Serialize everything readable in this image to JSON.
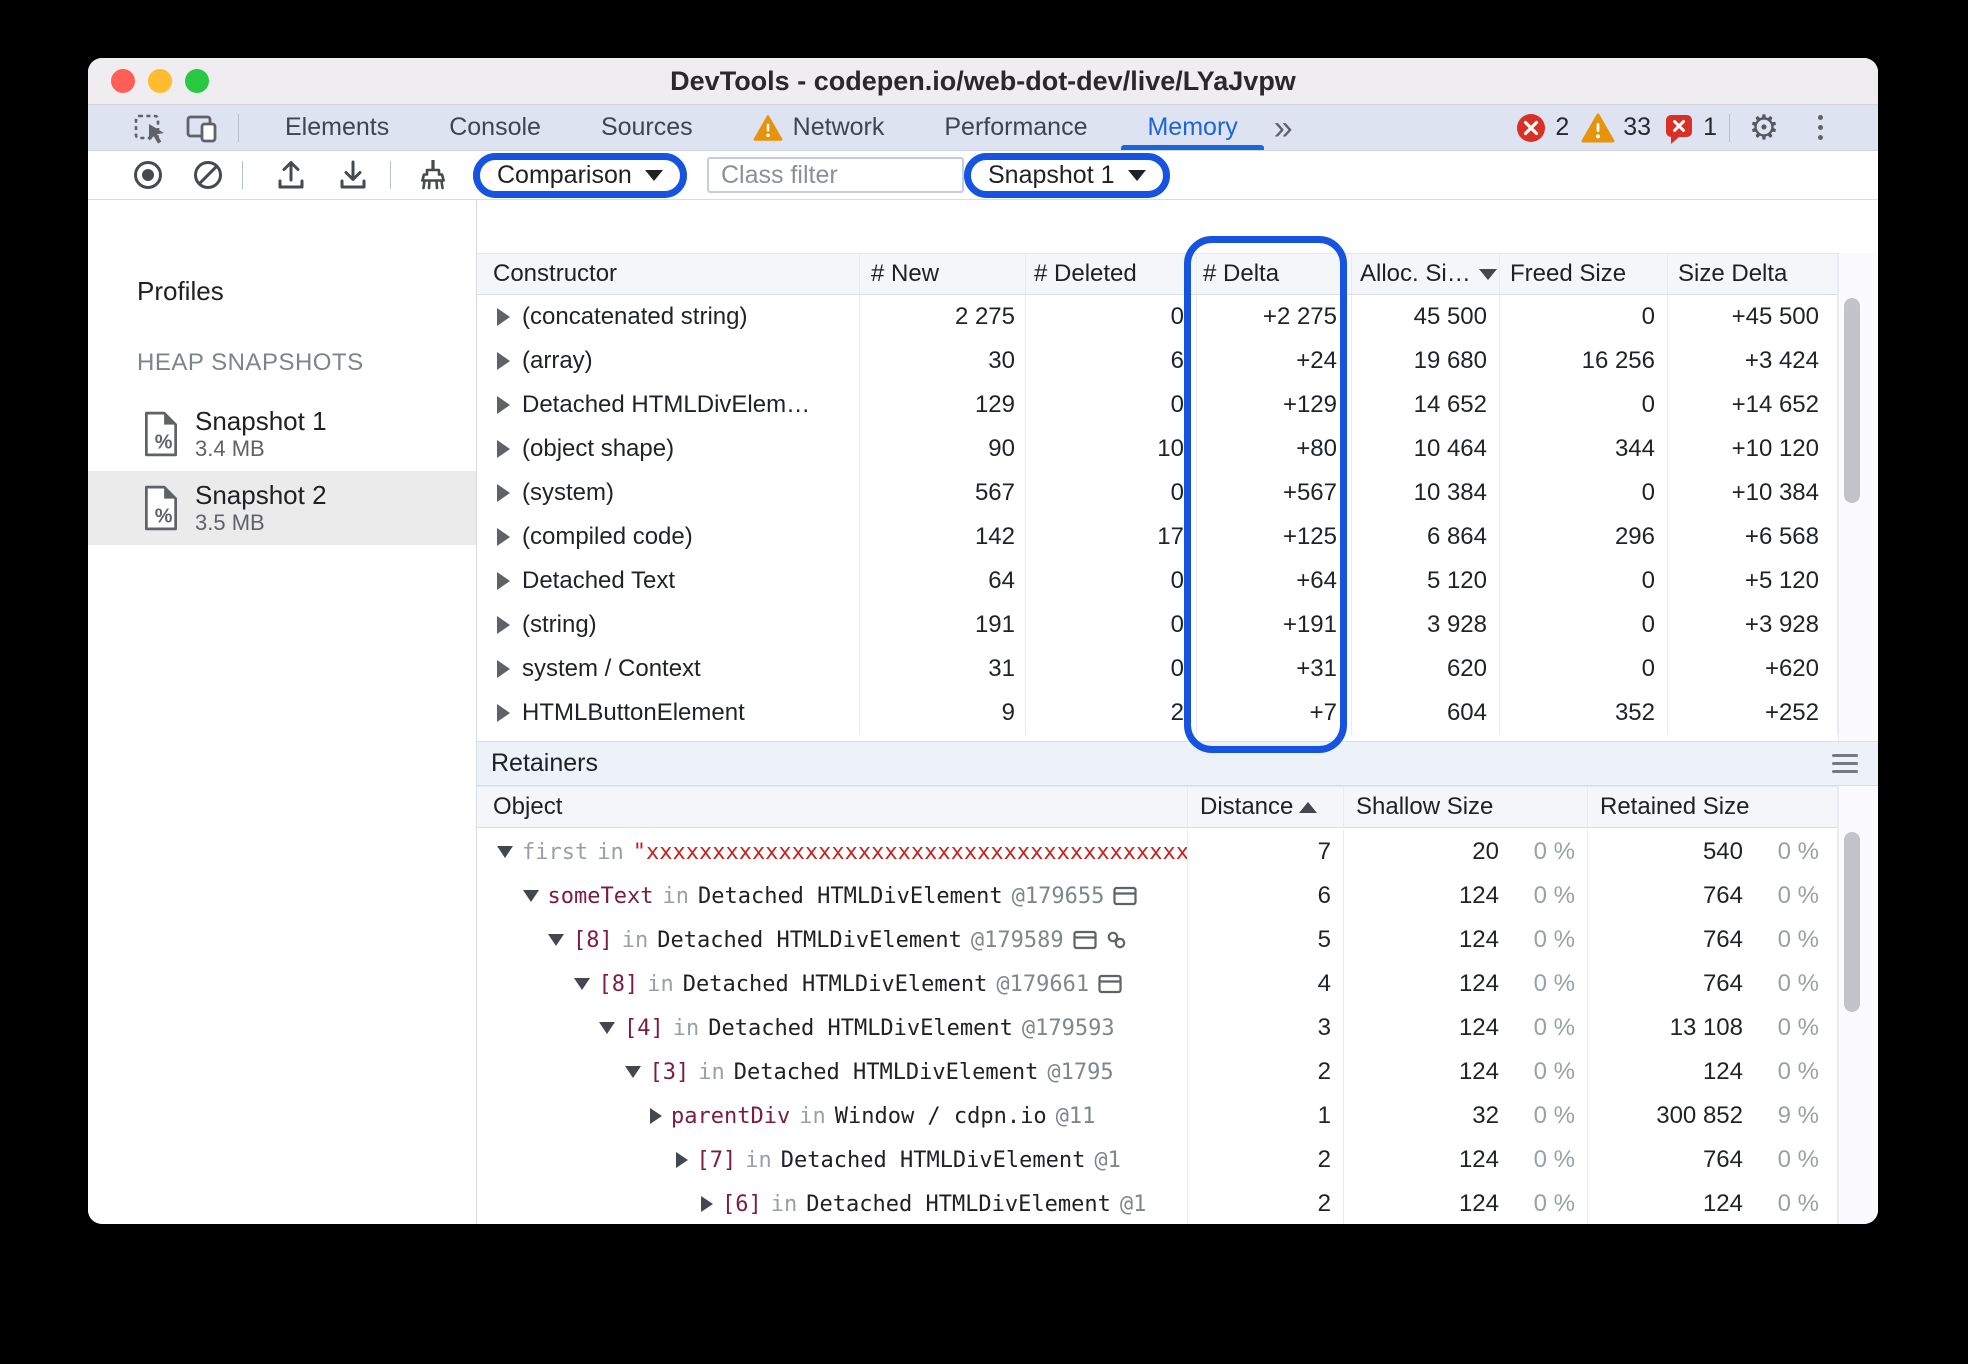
{
  "titlebar": {
    "title": "DevTools - codepen.io/web-dot-dev/live/LYaJvpw"
  },
  "tabbar": {
    "tabs": [
      {
        "label": "Elements"
      },
      {
        "label": "Console"
      },
      {
        "label": "Sources"
      },
      {
        "label": "Network",
        "warning": true
      },
      {
        "label": "Performance"
      },
      {
        "label": "Memory",
        "selected": true
      }
    ],
    "more_tabs_icon": "»",
    "gear_icon": "⚙",
    "badges": {
      "errors": "2",
      "warnings": "33",
      "issues": "1"
    }
  },
  "toolbar": {
    "comparison_label": "Comparison",
    "class_filter_placeholder": "Class filter",
    "snapshot_label": "Snapshot 1"
  },
  "sidebar": {
    "profiles_label": "Profiles",
    "section_label": "HEAP SNAPSHOTS",
    "snapshots": [
      {
        "name": "Snapshot 1",
        "size": "3.4 MB",
        "selected": false
      },
      {
        "name": "Snapshot 2",
        "size": "3.5 MB",
        "selected": true
      }
    ]
  },
  "comparison_table": {
    "columns": [
      "Constructor",
      "# New",
      "# Deleted",
      "# Delta",
      "Alloc. Si…",
      "Freed Size",
      "Size Delta"
    ],
    "sorted_column": "Alloc. Si…",
    "sort_direction": "desc",
    "highlighted_column": "# Delta",
    "rows": [
      {
        "constructor": "(concatenated string)",
        "new": "2 275",
        "deleted": "0",
        "delta": "+2 275",
        "alloc": "45 500",
        "freed": "0",
        "size_delta": "+45 500"
      },
      {
        "constructor": "(array)",
        "new": "30",
        "deleted": "6",
        "delta": "+24",
        "alloc": "19 680",
        "freed": "16 256",
        "size_delta": "+3 424"
      },
      {
        "constructor": "Detached HTMLDivElem…",
        "new": "129",
        "deleted": "0",
        "delta": "+129",
        "alloc": "14 652",
        "freed": "0",
        "size_delta": "+14 652"
      },
      {
        "constructor": "(object shape)",
        "new": "90",
        "deleted": "10",
        "delta": "+80",
        "alloc": "10 464",
        "freed": "344",
        "size_delta": "+10 120"
      },
      {
        "constructor": "(system)",
        "new": "567",
        "deleted": "0",
        "delta": "+567",
        "alloc": "10 384",
        "freed": "0",
        "size_delta": "+10 384"
      },
      {
        "constructor": "(compiled code)",
        "new": "142",
        "deleted": "17",
        "delta": "+125",
        "alloc": "6 864",
        "freed": "296",
        "size_delta": "+6 568"
      },
      {
        "constructor": "Detached Text",
        "new": "64",
        "deleted": "0",
        "delta": "+64",
        "alloc": "5 120",
        "freed": "0",
        "size_delta": "+5 120"
      },
      {
        "constructor": "(string)",
        "new": "191",
        "deleted": "0",
        "delta": "+191",
        "alloc": "3 928",
        "freed": "0",
        "size_delta": "+3 928"
      },
      {
        "constructor": "system / Context",
        "new": "31",
        "deleted": "0",
        "delta": "+31",
        "alloc": "620",
        "freed": "0",
        "size_delta": "+620"
      },
      {
        "constructor": "HTMLButtonElement",
        "new": "9",
        "deleted": "2",
        "delta": "+7",
        "alloc": "604",
        "freed": "352",
        "size_delta": "+252"
      }
    ]
  },
  "retainers": {
    "title": "Retainers",
    "columns": [
      "Object",
      "Distance",
      "Shallow Size",
      "Retained Size"
    ],
    "sorted_column": "Distance",
    "sort_direction": "asc",
    "rows": [
      {
        "level": 0,
        "expanded": true,
        "edge": "first",
        "edge_muted": true,
        "string": "\"xxxxxxxxxxxxxxxxxxxxxxxxxxxxxxxxxxxxxxxxxx",
        "object": "",
        "id": "",
        "icons": [],
        "distance": "7",
        "shallow": "20",
        "shallow_pct": "0 %",
        "retained": "540",
        "retained_pct": "0 %"
      },
      {
        "level": 1,
        "expanded": true,
        "edge": "someText",
        "edge_muted": false,
        "string": "",
        "object": "Detached HTMLDivElement",
        "id": "@179655",
        "icons": [
          "frame"
        ],
        "distance": "6",
        "shallow": "124",
        "shallow_pct": "0 %",
        "retained": "764",
        "retained_pct": "0 %"
      },
      {
        "level": 2,
        "expanded": true,
        "edge": "[8]",
        "edge_muted": false,
        "string": "",
        "object": "Detached HTMLDivElement",
        "id": "@179589",
        "icons": [
          "frame",
          "link"
        ],
        "distance": "5",
        "shallow": "124",
        "shallow_pct": "0 %",
        "retained": "764",
        "retained_pct": "0 %"
      },
      {
        "level": 3,
        "expanded": true,
        "edge": "[8]",
        "edge_muted": false,
        "string": "",
        "object": "Detached HTMLDivElement",
        "id": "@179661",
        "icons": [
          "frame"
        ],
        "distance": "4",
        "shallow": "124",
        "shallow_pct": "0 %",
        "retained": "764",
        "retained_pct": "0 %"
      },
      {
        "level": 4,
        "expanded": true,
        "edge": "[4]",
        "edge_muted": false,
        "string": "",
        "object": "Detached HTMLDivElement",
        "id": "@179593",
        "icons": [],
        "distance": "3",
        "shallow": "124",
        "shallow_pct": "0 %",
        "retained": "13 108",
        "retained_pct": "0 %"
      },
      {
        "level": 5,
        "expanded": true,
        "edge": "[3]",
        "edge_muted": false,
        "string": "",
        "object": "Detached HTMLDivElement",
        "id": "@1795",
        "icons": [],
        "distance": "2",
        "shallow": "124",
        "shallow_pct": "0 %",
        "retained": "124",
        "retained_pct": "0 %"
      },
      {
        "level": 6,
        "expanded": false,
        "edge": "parentDiv",
        "edge_muted": false,
        "string": "",
        "object": "Window / cdpn.io",
        "id": "@11",
        "icons": [],
        "distance": "1",
        "shallow": "32",
        "shallow_pct": "0 %",
        "retained": "300 852",
        "retained_pct": "9 %"
      },
      {
        "level": 7,
        "expanded": false,
        "edge": "[7]",
        "edge_muted": false,
        "string": "",
        "object": "Detached HTMLDivElement",
        "id": "@1",
        "icons": [],
        "distance": "2",
        "shallow": "124",
        "shallow_pct": "0 %",
        "retained": "764",
        "retained_pct": "0 %"
      },
      {
        "level": 8,
        "expanded": false,
        "edge": "[6]",
        "edge_muted": false,
        "string": "",
        "object": "Detached HTMLDivElement",
        "id": "@1",
        "icons": [],
        "distance": "2",
        "shallow": "124",
        "shallow_pct": "0 %",
        "retained": "124",
        "retained_pct": "0 %"
      }
    ]
  },
  "colors": {
    "highlight_blue": "#1553e0",
    "tab_blue": "#1b66d8",
    "error_red": "#d93025",
    "warning_orange": "#e8930c",
    "edge_maroon": "#7d1b42",
    "string_red": "#c5221f"
  }
}
